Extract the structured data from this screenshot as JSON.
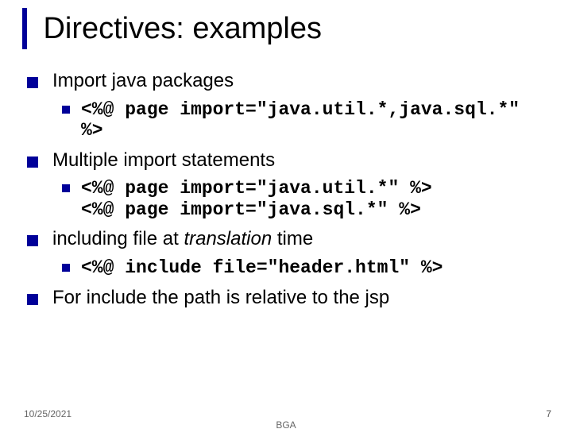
{
  "title": "Directives: examples",
  "bullets": {
    "b0": {
      "text": "Import java packages",
      "sub": {
        "code": "<%@ page import=\"java.util.*,java.sql.*\" %>"
      }
    },
    "b1": {
      "text": "Multiple import statements",
      "sub": {
        "code": "<%@ page import=\"java.util.*\" %>\n<%@ page import=\"java.sql.*\" %>"
      }
    },
    "b2": {
      "pre": "including file at ",
      "em": "translation",
      "post": "  time",
      "sub": {
        "code": "<%@ include file=\"header.html\" %>"
      }
    },
    "b3": {
      "text": "For include the path is relative to the jsp"
    }
  },
  "footer": {
    "date": "10/25/2021",
    "center": "BGA",
    "page": "7"
  }
}
